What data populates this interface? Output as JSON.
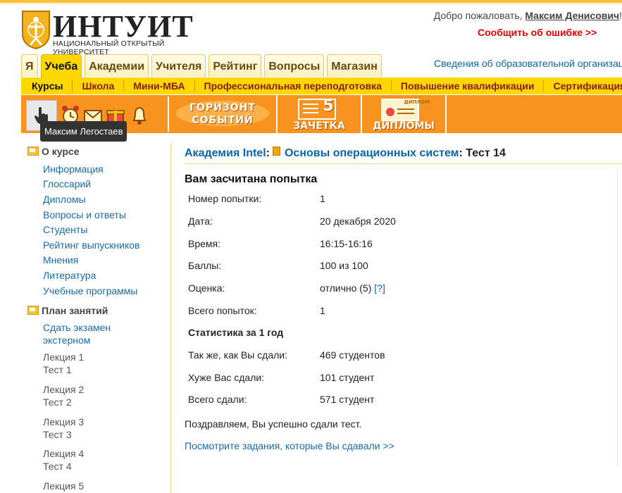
{
  "header": {
    "brand": "ИНТУИТ",
    "brand_sub": "НАЦИОНАЛЬНЫЙ ОТКРЫТЫЙ УНИВЕРСИТЕТ",
    "welcome_prefix": "Добро пожаловать, ",
    "user_name": "Максим Денисович",
    "welcome_suffix": "!",
    "report_error": "Сообщить об ошибке >>",
    "edu_info": "Сведения об образовательной организации"
  },
  "tabs": [
    "Я",
    "Учеба",
    "Академии",
    "Учителя",
    "Рейтинг",
    "Вопросы",
    "Магазин"
  ],
  "active_tab": "Учеба",
  "submenu": [
    "Курсы",
    "Школа",
    "Мини-МБА",
    "Профессиональная переподготовка",
    "Повышение квалификации",
    "Сертификация"
  ],
  "toolbar": {
    "horizon_1": "ГОРИЗОНТ",
    "horizon_2": "СОБЫТИЙ",
    "zachetka": "ЗАЧЕТКА",
    "zachetka_num": "5",
    "diplomas": "ДИПЛОМЫ",
    "diploma_small": "ДИПЛОМ"
  },
  "tooltip": "Максим Легостаев",
  "sidebar": {
    "about_title": "О курсе",
    "about_links": [
      "Информация",
      "Глоссарий",
      "Дипломы",
      "Вопросы и ответы",
      "Студенты",
      "Рейтинг выпускников",
      "Мнения",
      "Литература",
      "Учебные программы"
    ],
    "plan_title": "План занятий",
    "exam_link": "Сдать экзамен экстерном",
    "lectures": [
      {
        "lecture": "Лекция 1",
        "test": "Тест 1"
      },
      {
        "lecture": "Лекция 2",
        "test": "Тест 2"
      },
      {
        "lecture": "Лекция 3",
        "test": "Тест 3"
      },
      {
        "lecture": "Лекция 4",
        "test": "Тест 4"
      },
      {
        "lecture": "Лекция 5",
        "test": ""
      }
    ]
  },
  "breadcrumb": {
    "academy": "Академия Intel",
    "sep": ":",
    "course": "Основы операционных систем",
    "test": ": Тест 14"
  },
  "result": {
    "title": "Вам засчитана попытка",
    "rows": [
      {
        "label": "Номер попытки:",
        "value": "1"
      },
      {
        "label": "Дата:",
        "value": "20 декабря 2020"
      },
      {
        "label": "Время:",
        "value": "16:15-16:16"
      },
      {
        "label": "Баллы:",
        "value": "100 из 100"
      },
      {
        "label": "Оценка:",
        "value": "отлично (5)"
      },
      {
        "label": "Всего попыток:",
        "value": "1"
      }
    ],
    "help_link": "[?]",
    "stats_title": "Статистика за 1 год",
    "stats": [
      {
        "label": "Так же, как Вы сдали:",
        "value": "469 студентов"
      },
      {
        "label": "Хуже Вас сдали:",
        "value": "101 студент"
      },
      {
        "label": "Всего сдали:",
        "value": "571 студент"
      }
    ],
    "congrats": "Поздравляем, Вы успешно сдали тест.",
    "view_tasks": "Посмотрите задания, которые Вы сдавали >>"
  }
}
